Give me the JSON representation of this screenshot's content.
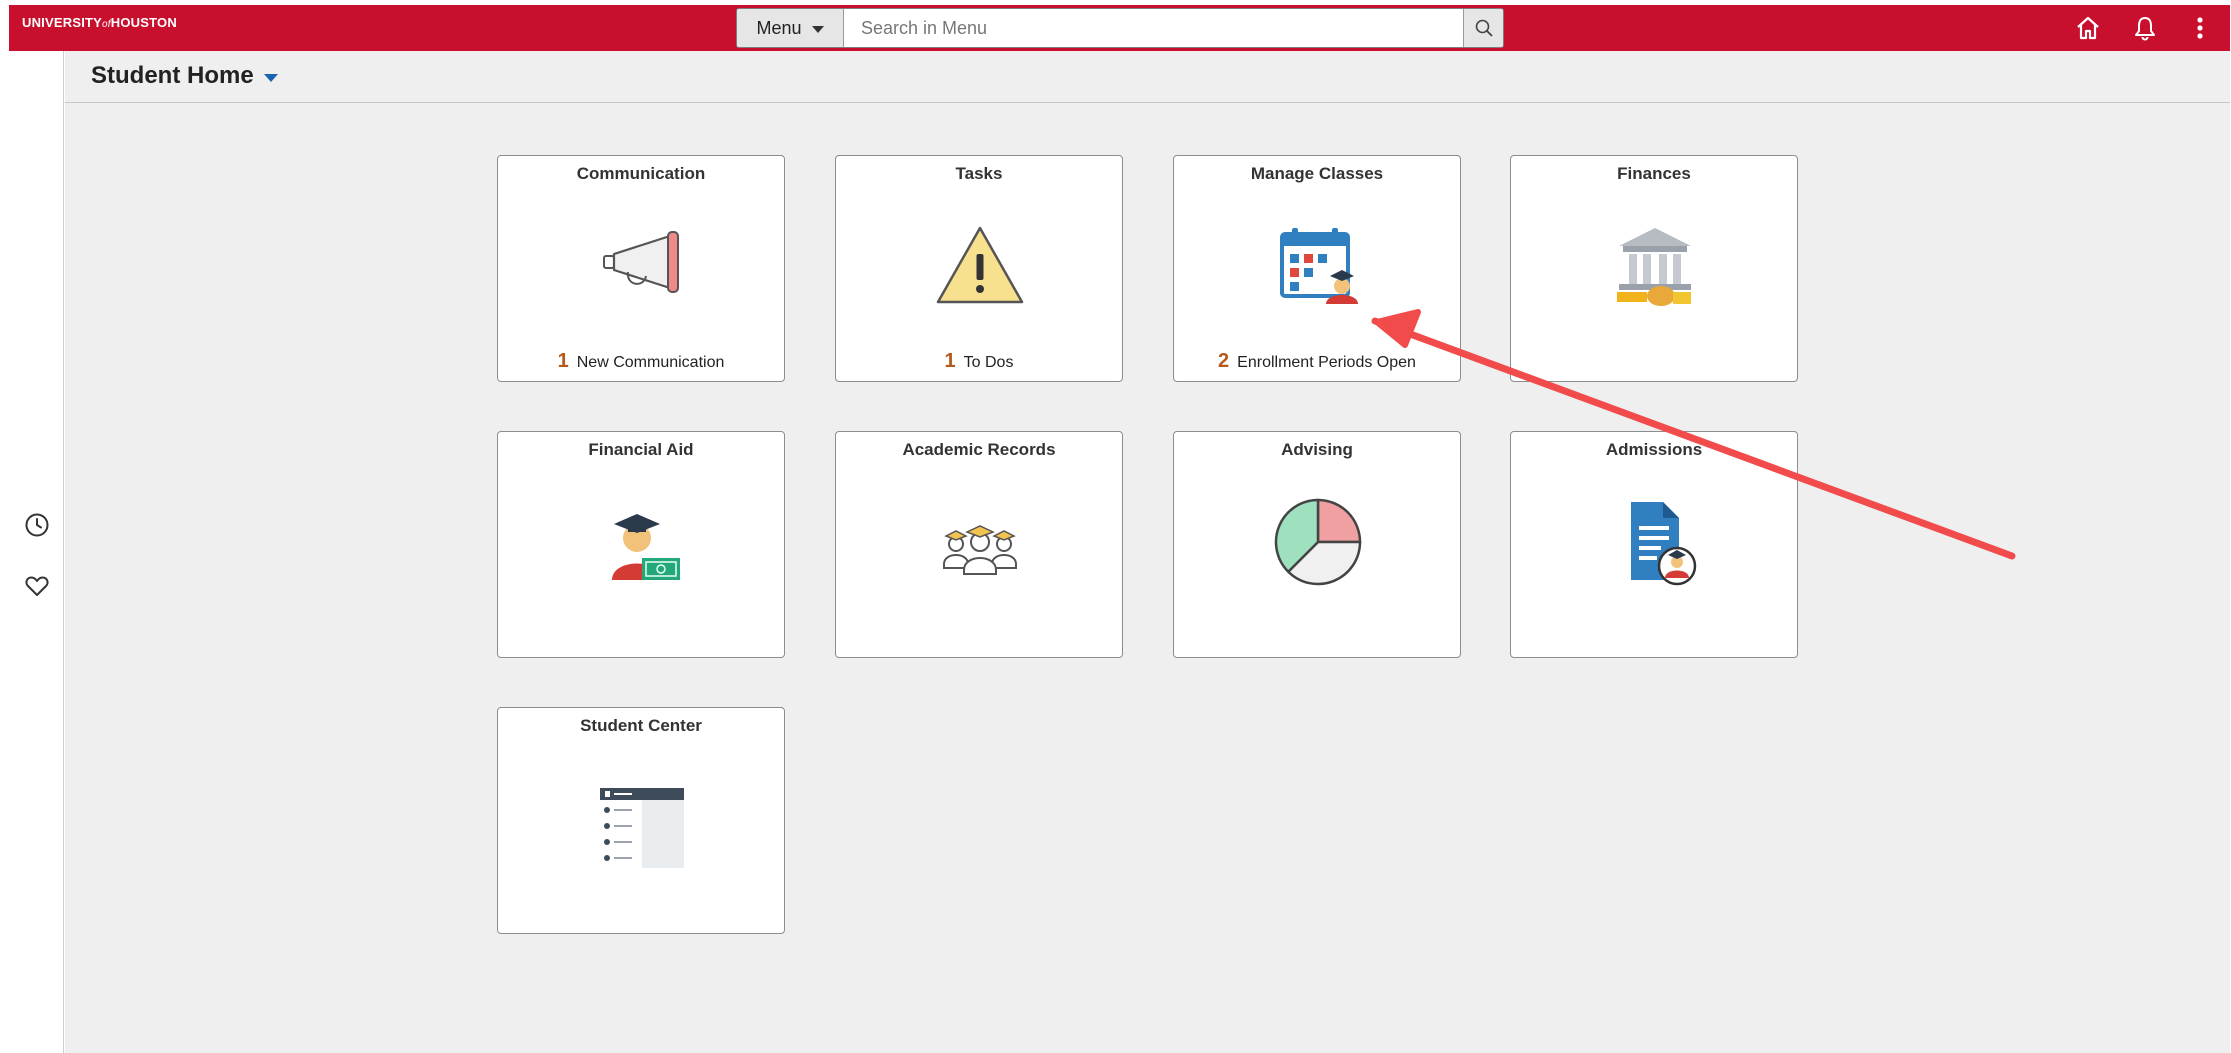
{
  "brand": {
    "part1": "UNIVERSITY",
    "part2": "of",
    "part3": "HOUSTON"
  },
  "topbar": {
    "menu_label": "Menu",
    "search_placeholder": "Search in Menu",
    "icons": [
      "home-icon",
      "bell-icon",
      "more-vertical-icon"
    ]
  },
  "sidebar": {
    "icons": [
      "clock-icon",
      "heart-icon"
    ]
  },
  "page": {
    "title": "Student Home"
  },
  "tiles": [
    {
      "title": "Communication",
      "count": "1",
      "foot": "New Communication",
      "icon": "megaphone-icon"
    },
    {
      "title": "Tasks",
      "count": "1",
      "foot": "To Dos",
      "icon": "warning-icon"
    },
    {
      "title": "Manage Classes",
      "count": "2",
      "foot": "Enrollment Periods Open",
      "icon": "calendar-student-icon"
    },
    {
      "title": "Finances",
      "count": "",
      "foot": "",
      "icon": "bank-icon"
    },
    {
      "title": "Financial Aid",
      "count": "",
      "foot": "",
      "icon": "graduate-money-icon"
    },
    {
      "title": "Academic Records",
      "count": "",
      "foot": "",
      "icon": "graduates-group-icon"
    },
    {
      "title": "Advising",
      "count": "",
      "foot": "",
      "icon": "pie-chart-icon"
    },
    {
      "title": "Admissions",
      "count": "",
      "foot": "",
      "icon": "document-student-icon"
    },
    {
      "title": "Student Center",
      "count": "",
      "foot": "",
      "icon": "dashboard-icon"
    }
  ],
  "colors": {
    "brand_red": "#c8102e",
    "arrow_red": "#f24b4b",
    "count_orange": "#b45a1b",
    "content_bg": "#efefef"
  }
}
